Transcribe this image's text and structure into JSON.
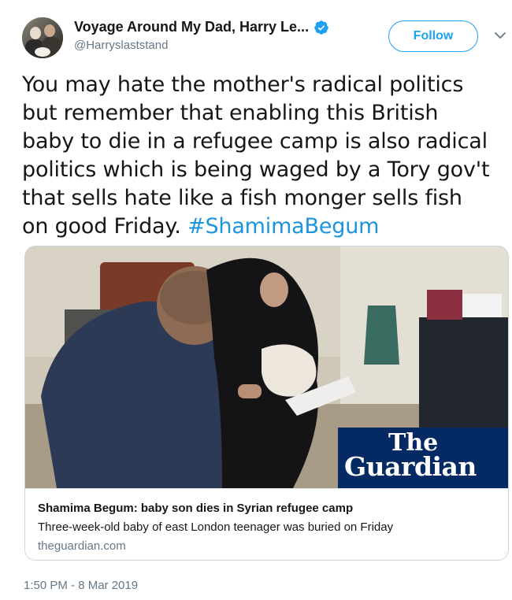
{
  "author": {
    "display_name": "Voyage Around My Dad, Harry Le...",
    "handle": "@Harryslaststand",
    "verified": true
  },
  "actions": {
    "follow_label": "Follow"
  },
  "tweet": {
    "text": "You may hate the mother's radical politics but remember that enabling this British baby to die in a refugee camp is also radical politics which is being waged by a Tory gov't that sells hate like a fish monger sells fish on good Friday. ",
    "hashtag": "#ShamimaBegum"
  },
  "card": {
    "logo_line1": "The",
    "logo_line2": "Guardian",
    "title": "Shamima Begum: baby son dies in Syrian refugee camp",
    "description": "Three-week-old baby of east London teenager was buried on Friday",
    "domain": "theguardian.com"
  },
  "timestamp": "1:50 PM - 8 Mar 2019",
  "colors": {
    "accent": "#1da1f2",
    "hashtag": "#1b95e0",
    "guardian_blue": "#052962",
    "muted": "#657786"
  },
  "icons": {
    "verified": "verified-badge-icon",
    "menu": "chevron-down-icon"
  }
}
